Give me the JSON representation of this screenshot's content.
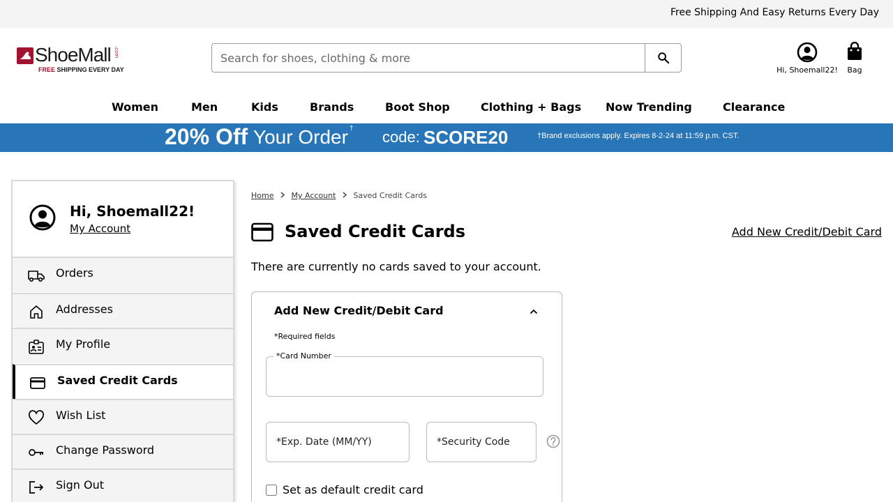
{
  "topbar": {
    "text": "Free Shipping And Easy Returns Every Day"
  },
  "logo": {
    "word": "ShoeMall",
    "com": ".com",
    "tag_free": "FREE",
    "tag_rest": " SHIPPING EVERY DAY"
  },
  "search": {
    "placeholder": "Search for shoes, clothing & more",
    "icon": "search-icon"
  },
  "header": {
    "account_label": "Hi, Shoemall22!",
    "bag_label": "Bag"
  },
  "nav": {
    "items": [
      {
        "label": "Women"
      },
      {
        "label": "Men"
      },
      {
        "label": "Kids"
      },
      {
        "label": "Brands"
      },
      {
        "label": "Boot Shop"
      },
      {
        "label": "Clothing + Bags"
      },
      {
        "label": "Now Trending"
      },
      {
        "label": "Clearance"
      }
    ]
  },
  "promo": {
    "amount": "20% Off",
    "rest": "Your Order",
    "dagger": "†",
    "code_label": "code:",
    "code": "SCORE20",
    "fine_print": "†Brand exclusions apply. Expires 8-2-24 at 11:59 p.m. CST."
  },
  "sidebar": {
    "greeting": "Hi, Shoemall22!",
    "account_link": "My Account",
    "items": [
      {
        "label": "Orders",
        "icon": "truck-icon"
      },
      {
        "label": "Addresses",
        "icon": "home-icon"
      },
      {
        "label": "My Profile",
        "icon": "id-card-icon"
      },
      {
        "label": "Saved Credit Cards",
        "icon": "credit-card-icon",
        "active": true
      },
      {
        "label": "Wish List",
        "icon": "heart-icon"
      },
      {
        "label": "Change Password",
        "icon": "key-icon"
      },
      {
        "label": "Sign Out",
        "icon": "sign-out-icon"
      }
    ]
  },
  "breadcrumb": {
    "home": "Home",
    "account": "My Account",
    "current": "Saved Credit Cards"
  },
  "main": {
    "title": "Saved Credit Cards",
    "add_link": "Add New Credit/Debit Card",
    "empty_message": "There are currently no cards saved to your account."
  },
  "form": {
    "title": "Add New Credit/Debit Card",
    "required_note": "*Required fields",
    "card_number_label": "*Card Number",
    "card_number_value": "",
    "exp_placeholder": "*Exp. Date (MM/YY)",
    "cvv_placeholder": "*Security Code",
    "default_label": "Set as default credit card",
    "default_checked": false
  },
  "colors": {
    "promo_blue": "#2875b8",
    "brand_red": "#a3122f",
    "sidebar_bg": "#f4f4f4"
  }
}
